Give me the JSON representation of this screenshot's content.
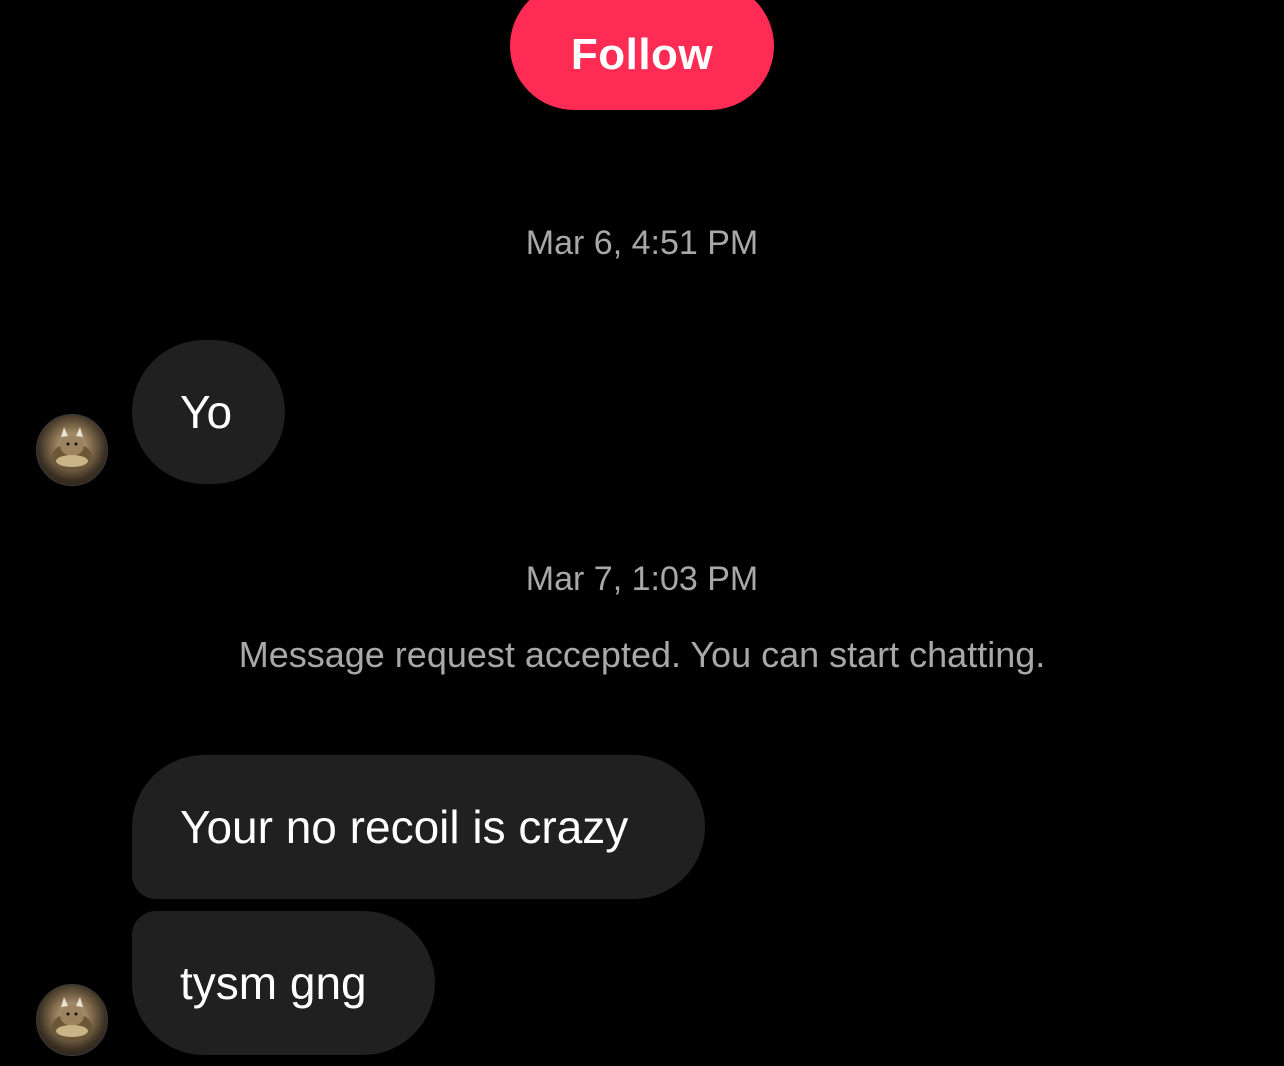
{
  "header": {
    "follow_label": "Follow",
    "follow_color": "#fe2c55"
  },
  "chat": {
    "timestamp_1": "Mar 6, 4:51 PM",
    "timestamp_2": "Mar 7, 1:03 PM",
    "system_note": "Message request accepted. You can start chatting.",
    "messages": [
      {
        "text": "Yo",
        "sender": "other"
      },
      {
        "text": "Your no recoil is crazy",
        "sender": "other"
      },
      {
        "text": "tysm gng",
        "sender": "other"
      }
    ],
    "bubble_color": "#202020",
    "avatar_icon": "cat-avatar"
  }
}
